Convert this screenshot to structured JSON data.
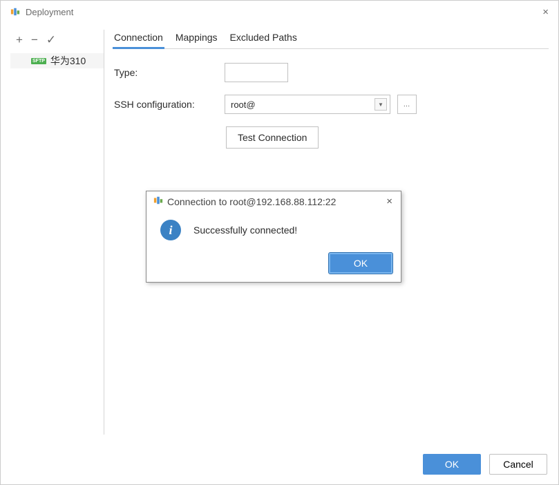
{
  "window": {
    "title": "Deployment",
    "close_glyph": "×"
  },
  "toolbar": {
    "add_glyph": "+",
    "remove_glyph": "−",
    "check_glyph": "✓"
  },
  "servers": [
    {
      "badge": "SFTP",
      "name": "华为310"
    }
  ],
  "tabs": {
    "connection": "Connection",
    "mappings": "Mappings",
    "excluded": "Excluded Paths"
  },
  "form": {
    "type_label": "Type:",
    "type_value": "",
    "ssh_label": "SSH configuration:",
    "ssh_value": "root@",
    "browse_glyph": "…",
    "test_label": "Test Connection"
  },
  "popup": {
    "title": "Connection to root@192.168.88.112:22",
    "message": "Successfully connected!",
    "ok_label": "OK",
    "close_glyph": "×",
    "info_glyph": "i"
  },
  "footer": {
    "ok_label": "OK",
    "cancel_label": "Cancel"
  }
}
